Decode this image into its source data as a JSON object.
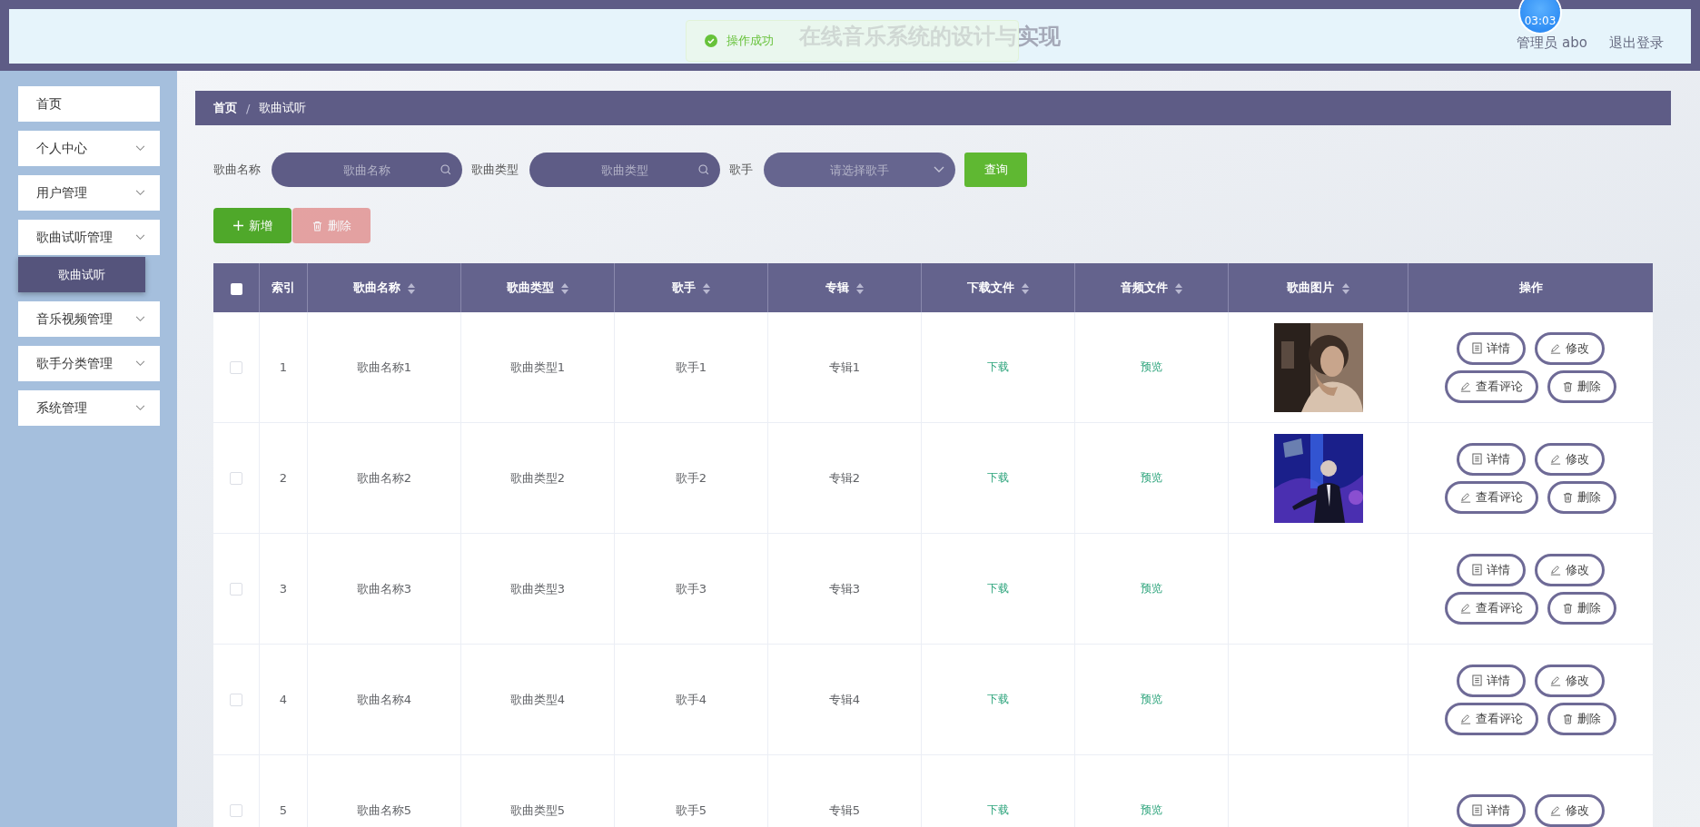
{
  "header": {
    "title": "在线音乐系统的设计与实现",
    "clock": "03:03",
    "user": "管理员 abo",
    "logout": "退出登录"
  },
  "toast": {
    "kind": "success",
    "message": "操作成功"
  },
  "sidebar": {
    "items": [
      {
        "label": "首页",
        "kind": "link"
      },
      {
        "label": "个人中心",
        "kind": "menu"
      },
      {
        "label": "用户管理",
        "kind": "menu"
      },
      {
        "label": "歌曲试听管理",
        "kind": "menu",
        "children": [
          {
            "label": "歌曲试听",
            "selected": true
          }
        ]
      },
      {
        "label": "音乐视频管理",
        "kind": "menu"
      },
      {
        "label": "歌手分类管理",
        "kind": "menu"
      },
      {
        "label": "系统管理",
        "kind": "menu"
      }
    ]
  },
  "breadcrumb": {
    "items": [
      "首页",
      "歌曲试听"
    ],
    "separator": "/"
  },
  "filters": [
    {
      "label": "歌曲名称",
      "kind": "search",
      "placeholder": "歌曲名称"
    },
    {
      "label": "歌曲类型",
      "kind": "search",
      "placeholder": "歌曲类型"
    },
    {
      "label": "歌手",
      "kind": "select",
      "placeholder": "请选择歌手"
    }
  ],
  "query_button": "查询",
  "toolbar": [
    {
      "label": "新增",
      "kind": "add",
      "disabled": false
    },
    {
      "label": "删除",
      "kind": "delete",
      "disabled": true
    }
  ],
  "table": {
    "header_checked": false,
    "columns": [
      {
        "label": "索引",
        "sortable": false
      },
      {
        "label": "歌曲名称",
        "sortable": true
      },
      {
        "label": "歌曲类型",
        "sortable": true
      },
      {
        "label": "歌手",
        "sortable": true
      },
      {
        "label": "专辑",
        "sortable": true
      },
      {
        "label": "下载文件",
        "sortable": true
      },
      {
        "label": "音频文件",
        "sortable": true
      },
      {
        "label": "歌曲图片",
        "sortable": true
      },
      {
        "label": "操作",
        "sortable": false
      }
    ],
    "rows": [
      {
        "checked": false,
        "index": "1",
        "name": "歌曲名称1",
        "type": "歌曲类型1",
        "singer": "歌手1",
        "album": "专辑1",
        "download": "下载",
        "preview": "预览",
        "image": {
          "kind": "picture"
        },
        "actions": [
          {
            "kind": "detail",
            "label": "详情"
          },
          {
            "kind": "edit",
            "label": "修改"
          },
          {
            "kind": "comment",
            "label": "查看评论"
          },
          {
            "kind": "delete",
            "label": "删除"
          }
        ]
      },
      {
        "checked": false,
        "index": "2",
        "name": "歌曲名称2",
        "type": "歌曲类型2",
        "singer": "歌手2",
        "album": "专辑2",
        "download": "下载",
        "preview": "预览",
        "image": {
          "kind": "picture"
        },
        "actions": [
          {
            "kind": "detail",
            "label": "详情"
          },
          {
            "kind": "edit",
            "label": "修改"
          },
          {
            "kind": "comment",
            "label": "查看评论"
          },
          {
            "kind": "delete",
            "label": "删除"
          }
        ]
      },
      {
        "checked": false,
        "index": "3",
        "name": "歌曲名称3",
        "type": "歌曲类型3",
        "singer": "歌手3",
        "album": "专辑3",
        "download": "下载",
        "preview": "预览",
        "actions": [
          {
            "kind": "detail",
            "label": "详情"
          },
          {
            "kind": "edit",
            "label": "修改"
          },
          {
            "kind": "comment",
            "label": "查看评论"
          },
          {
            "kind": "delete",
            "label": "删除"
          }
        ]
      },
      {
        "checked": false,
        "index": "4",
        "name": "歌曲名称4",
        "type": "歌曲类型4",
        "singer": "歌手4",
        "album": "专辑4",
        "download": "下载",
        "preview": "预览",
        "actions": [
          {
            "kind": "detail",
            "label": "详情"
          },
          {
            "kind": "edit",
            "label": "修改"
          },
          {
            "kind": "comment",
            "label": "查看评论"
          },
          {
            "kind": "delete",
            "label": "删除"
          }
        ]
      },
      {
        "checked": false,
        "index": "5",
        "name": "歌曲名称5",
        "type": "歌曲类型5",
        "singer": "歌手5",
        "album": "专辑5",
        "download": "下载",
        "preview": "预览",
        "actions": [
          {
            "kind": "detail",
            "label": "详情"
          },
          {
            "kind": "edit",
            "label": "修改"
          }
        ]
      }
    ]
  }
}
